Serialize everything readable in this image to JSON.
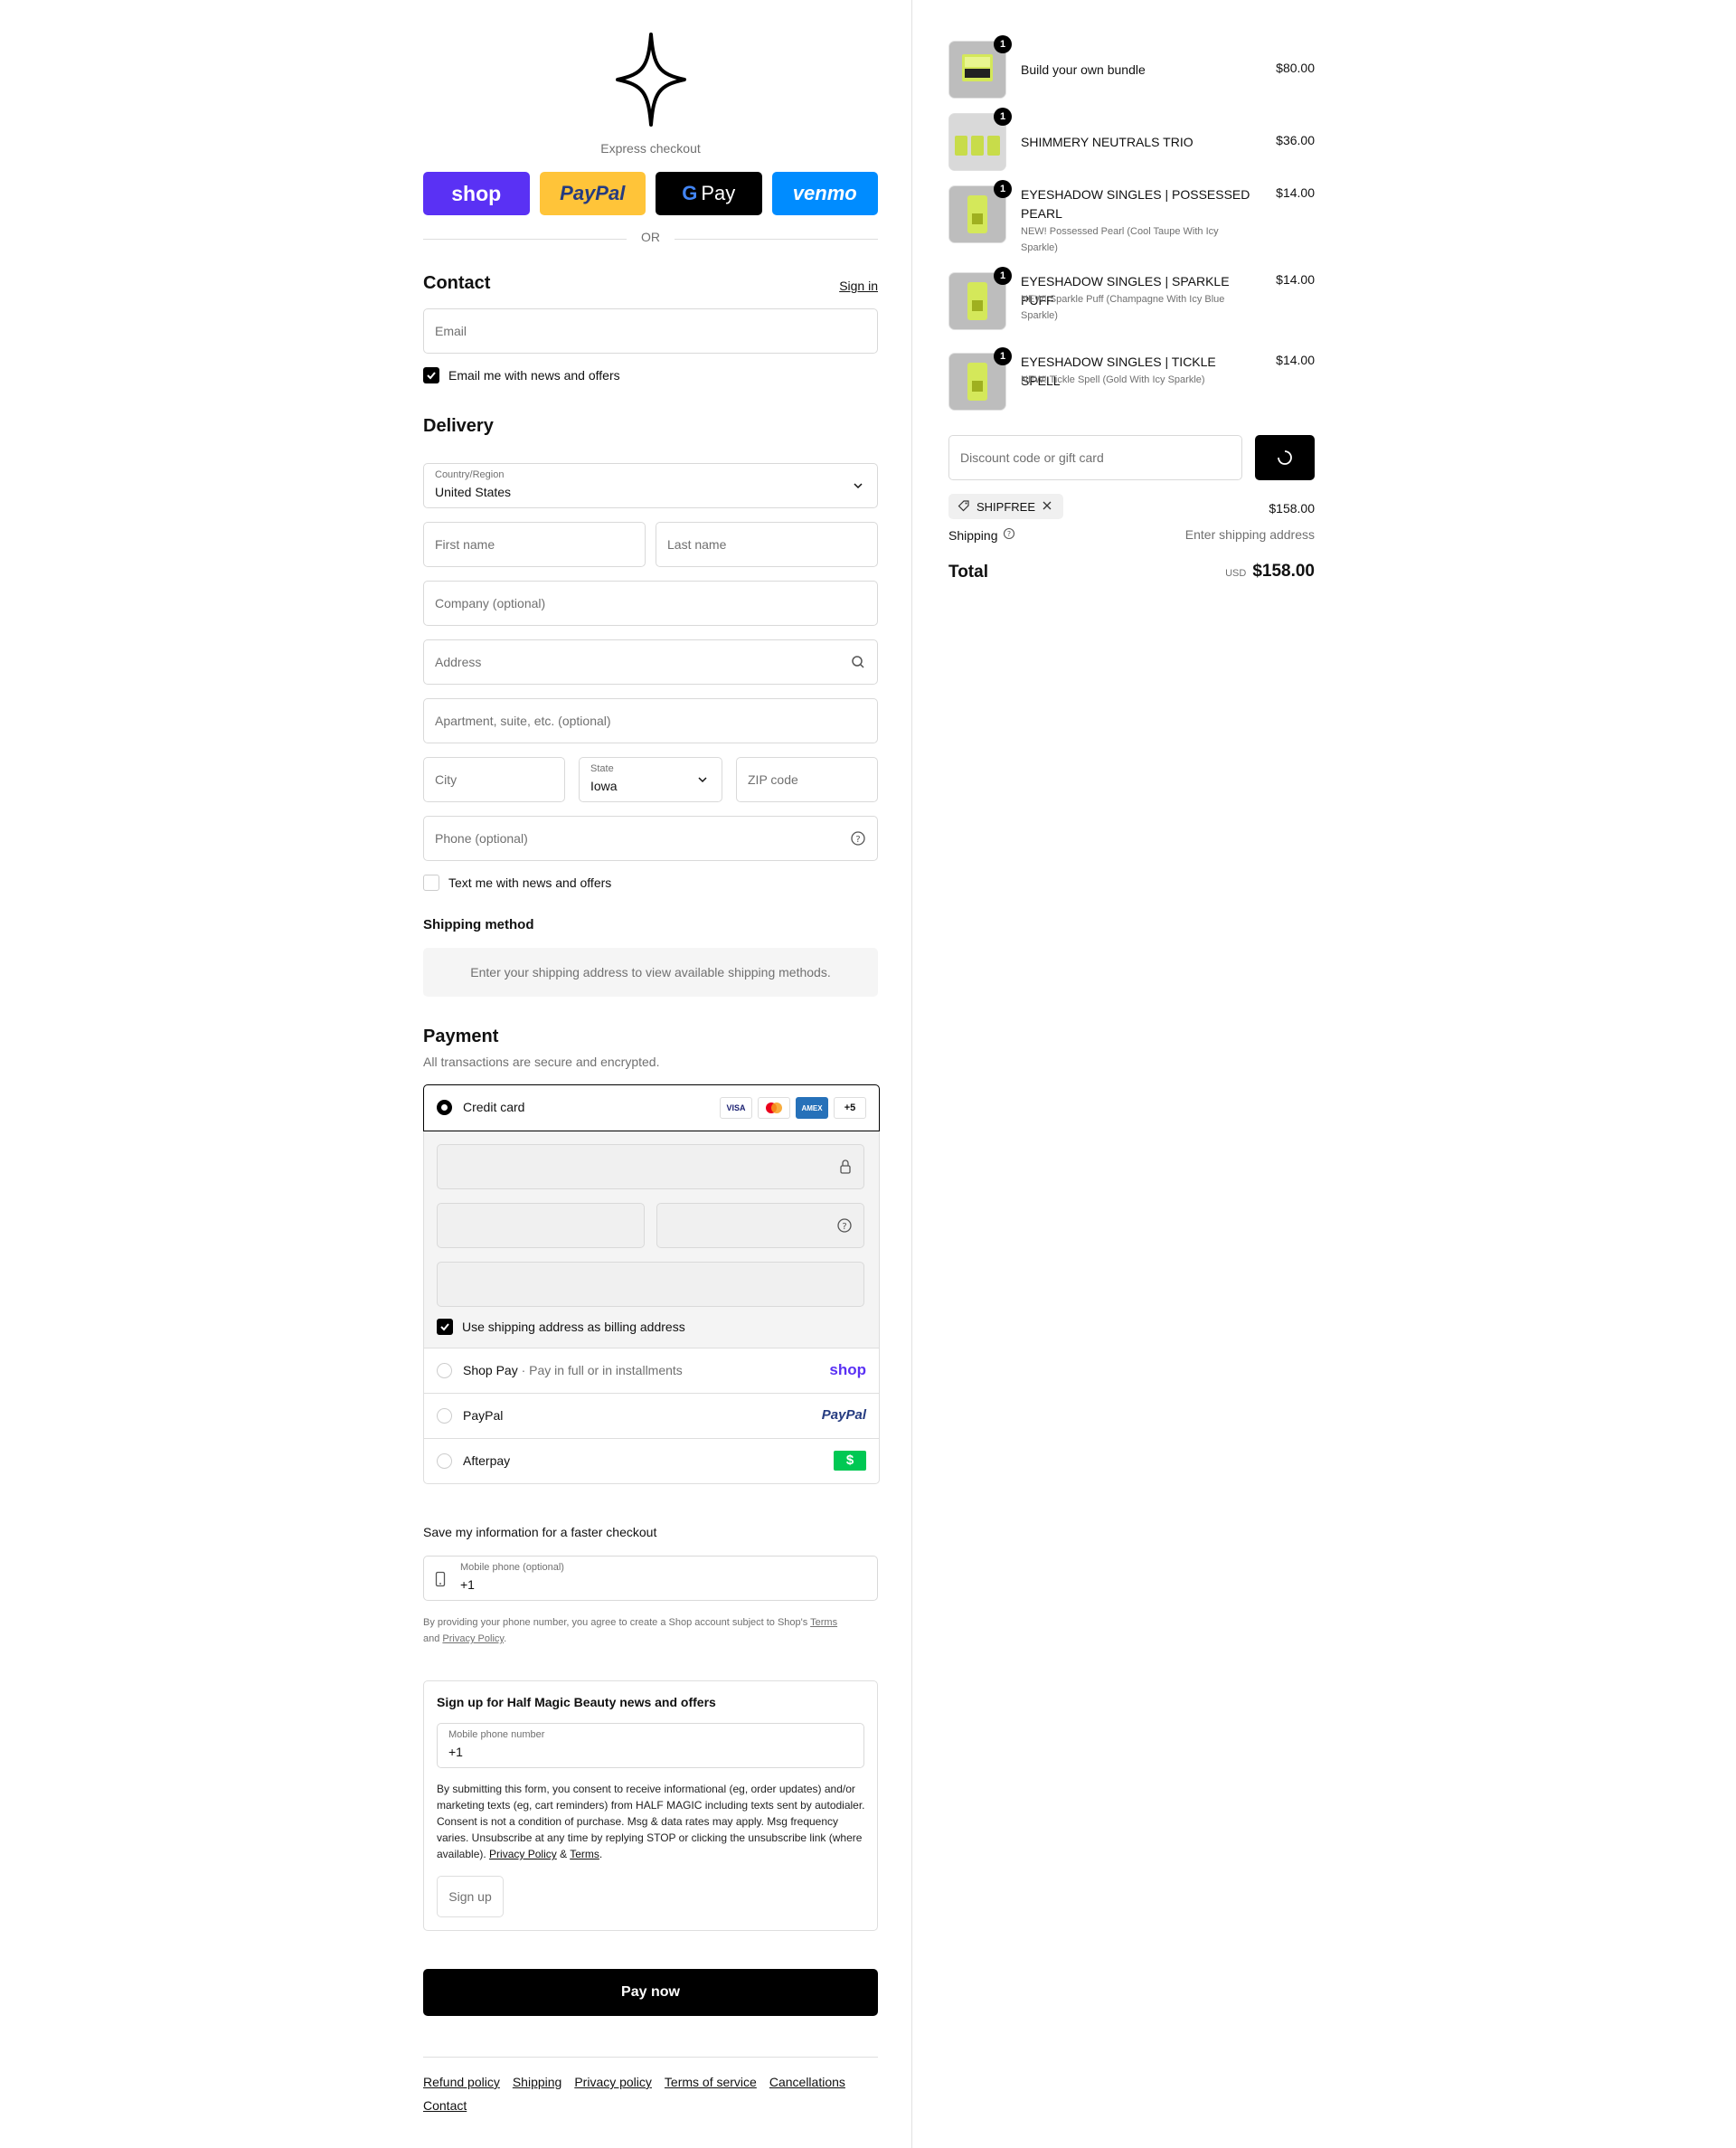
{
  "express": {
    "label": "Express checkout",
    "shop": "shop",
    "paypal": "PayPal",
    "gpay": "Pay",
    "venmo": "venmo",
    "or": "OR"
  },
  "contact": {
    "title": "Contact",
    "signin": "Sign in",
    "email_placeholder": "Email",
    "news_label": "Email me with news and offers"
  },
  "delivery": {
    "title": "Delivery",
    "country_label": "Country/Region",
    "country_value": "United States",
    "first_name": "First name",
    "last_name": "Last name",
    "company": "Company (optional)",
    "address": "Address",
    "apartment": "Apartment, suite, etc. (optional)",
    "city": "City",
    "state_label": "State",
    "state_value": "Iowa",
    "zip": "ZIP code",
    "phone": "Phone (optional)",
    "text_label": "Text me with news and offers"
  },
  "shipping_method": {
    "title": "Shipping method",
    "message": "Enter your shipping address to view available shipping methods."
  },
  "payment": {
    "title": "Payment",
    "subtitle": "All transactions are secure and encrypted.",
    "credit_card": "Credit card",
    "cards": [
      "VISA",
      "",
      "AMEX",
      "+5"
    ],
    "billing_label": "Use shipping address as billing address",
    "shop_pay": "Shop Pay",
    "shop_pay_sub": "Pay in full or in installments",
    "shop_logo": "shop",
    "paypal": "PayPal",
    "paypal_logo": "PayPal",
    "afterpay": "Afterpay",
    "afterpay_logo": "$"
  },
  "save_info": {
    "title": "Save my information for a faster checkout",
    "phone_label": "Mobile phone (optional)",
    "phone_value": "+1",
    "legal_pre": "By providing your phone number, you agree to create a Shop account subject to Shop's",
    "terms": "Terms",
    "and": "and",
    "privacy": "Privacy Policy",
    "period": "."
  },
  "signup": {
    "title": "Sign up for Half Magic Beauty news and offers",
    "phone_label": "Mobile phone number",
    "phone_value": "+1",
    "consent": "By submitting this form, you consent to receive informational (eg, order updates) and/or marketing texts (eg, cart reminders) from HALF MAGIC including texts sent by autodialer. Consent is not a condition of purchase. Msg & data rates may apply. Msg frequency varies. Unsubscribe at any time by replying STOP or clicking the unsubscribe link (where available).",
    "privacy": "Privacy Policy",
    "amp": "&",
    "terms": "Terms",
    "button": "Sign up"
  },
  "pay_now": "Pay now",
  "footer": [
    "Refund policy",
    "Shipping",
    "Privacy policy",
    "Terms of service",
    "Cancellations",
    "Contact"
  ],
  "cart": {
    "items": [
      {
        "name": "Build your own bundle",
        "variant": "",
        "price": "$80.00",
        "qty": "1"
      },
      {
        "name": "SHIMMERY NEUTRALS TRIO",
        "variant": "",
        "price": "$36.00",
        "qty": "1"
      },
      {
        "name": "EYESHADOW SINGLES | POSSESSED PEARL",
        "variant": "NEW! Possessed Pearl (Cool Taupe With Icy Sparkle)",
        "price": "$14.00",
        "qty": "1"
      },
      {
        "name": "EYESHADOW SINGLES | SPARKLE PUFF",
        "variant": "NEW! Sparkle Puff (Champagne With Icy Blue Sparkle)",
        "price": "$14.00",
        "qty": "1"
      },
      {
        "name": "EYESHADOW SINGLES | TICKLE SPELL",
        "variant": "NEW! Tickle Spell (Gold With Icy Sparkle)",
        "price": "$14.00",
        "qty": "1"
      }
    ],
    "discount_placeholder": "Discount code or gift card",
    "code": "SHIPFREE",
    "subtotal": "$158.00",
    "shipping_label": "Shipping",
    "shipping_value": "Enter shipping address",
    "total_label": "Total",
    "currency": "USD",
    "total": "$158.00"
  },
  "colors": {
    "shop": "#5a31f4",
    "paypal": "#ffc439",
    "venmo": "#008cff",
    "afterpay": "#00c853",
    "product": "#d4e85a"
  }
}
